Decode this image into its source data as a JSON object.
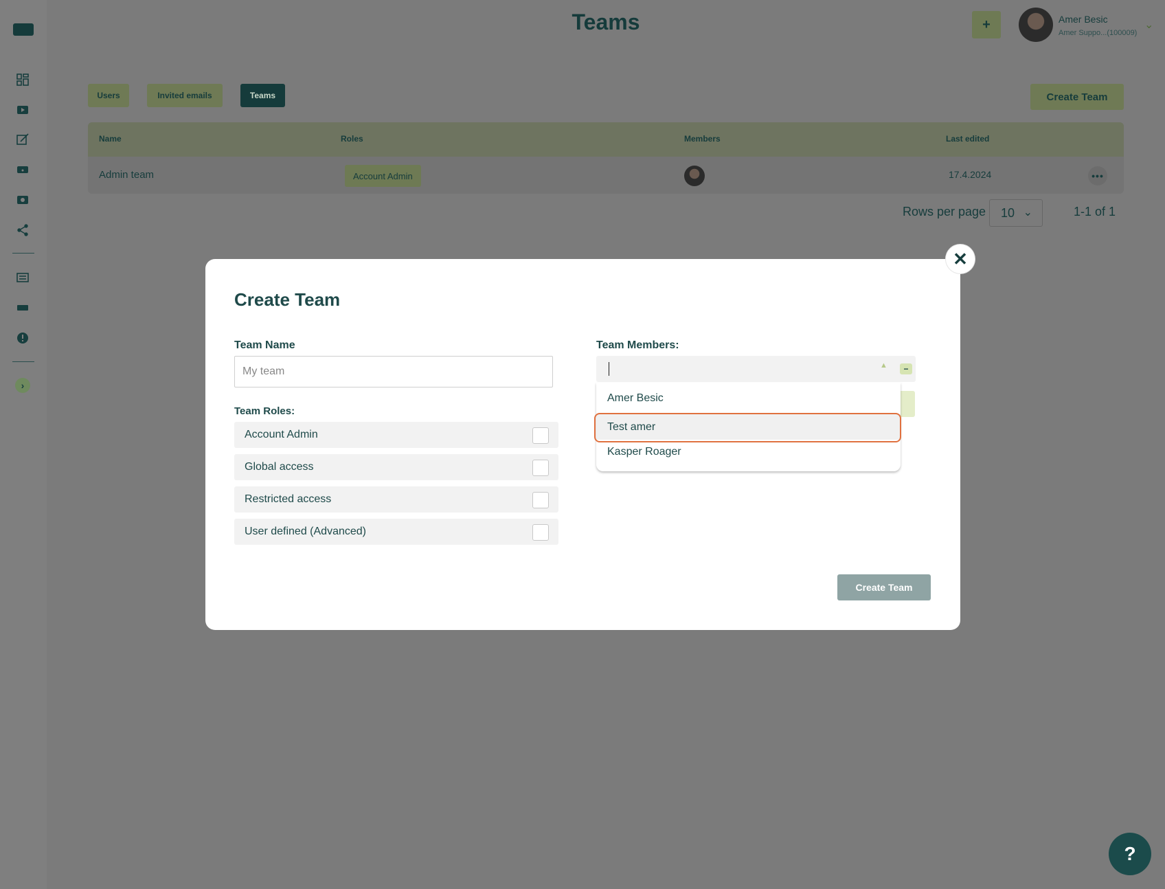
{
  "page": {
    "title": "Teams"
  },
  "header": {
    "add_label": "+",
    "user_name": "Amer Besic",
    "user_sub": "Amer Suppo...(100009)"
  },
  "tabs": [
    {
      "label": "Users"
    },
    {
      "label": "Invited emails"
    },
    {
      "label": "Teams"
    }
  ],
  "toolbar": {
    "create_team_label": "Create Team"
  },
  "table": {
    "headers": [
      "Name",
      "Roles",
      "Members",
      "Last edited"
    ],
    "rows": [
      {
        "name": "Admin team",
        "role": "Account Admin",
        "last_edited": "17.4.2024",
        "more": "•••"
      }
    ]
  },
  "pagination": {
    "rows_label": "Rows per page",
    "rows_value": "10",
    "range": "1-1 of 1"
  },
  "modal": {
    "title": "Create Team",
    "team_name_label": "Team Name",
    "team_name_placeholder": "My team",
    "roles_label": "Team Roles:",
    "roles": [
      {
        "label": "Account Admin",
        "checked": false
      },
      {
        "label": "Global access",
        "checked": false
      },
      {
        "label": "Restricted access",
        "checked": false
      },
      {
        "label": "User defined (Advanced)",
        "checked": false
      }
    ],
    "members_label": "Team Members:",
    "members_value": "",
    "members_options": [
      "Amer Besic",
      "Test amer",
      "Kasper Roager"
    ],
    "highlighted_option": "Test amer",
    "create_label": "Create Team",
    "close_icon": "close-icon"
  },
  "help": {
    "label": "?"
  },
  "colors": {
    "primary": "#153b3b",
    "accent": "#d6e4b2",
    "highlight": "#e0713f"
  }
}
